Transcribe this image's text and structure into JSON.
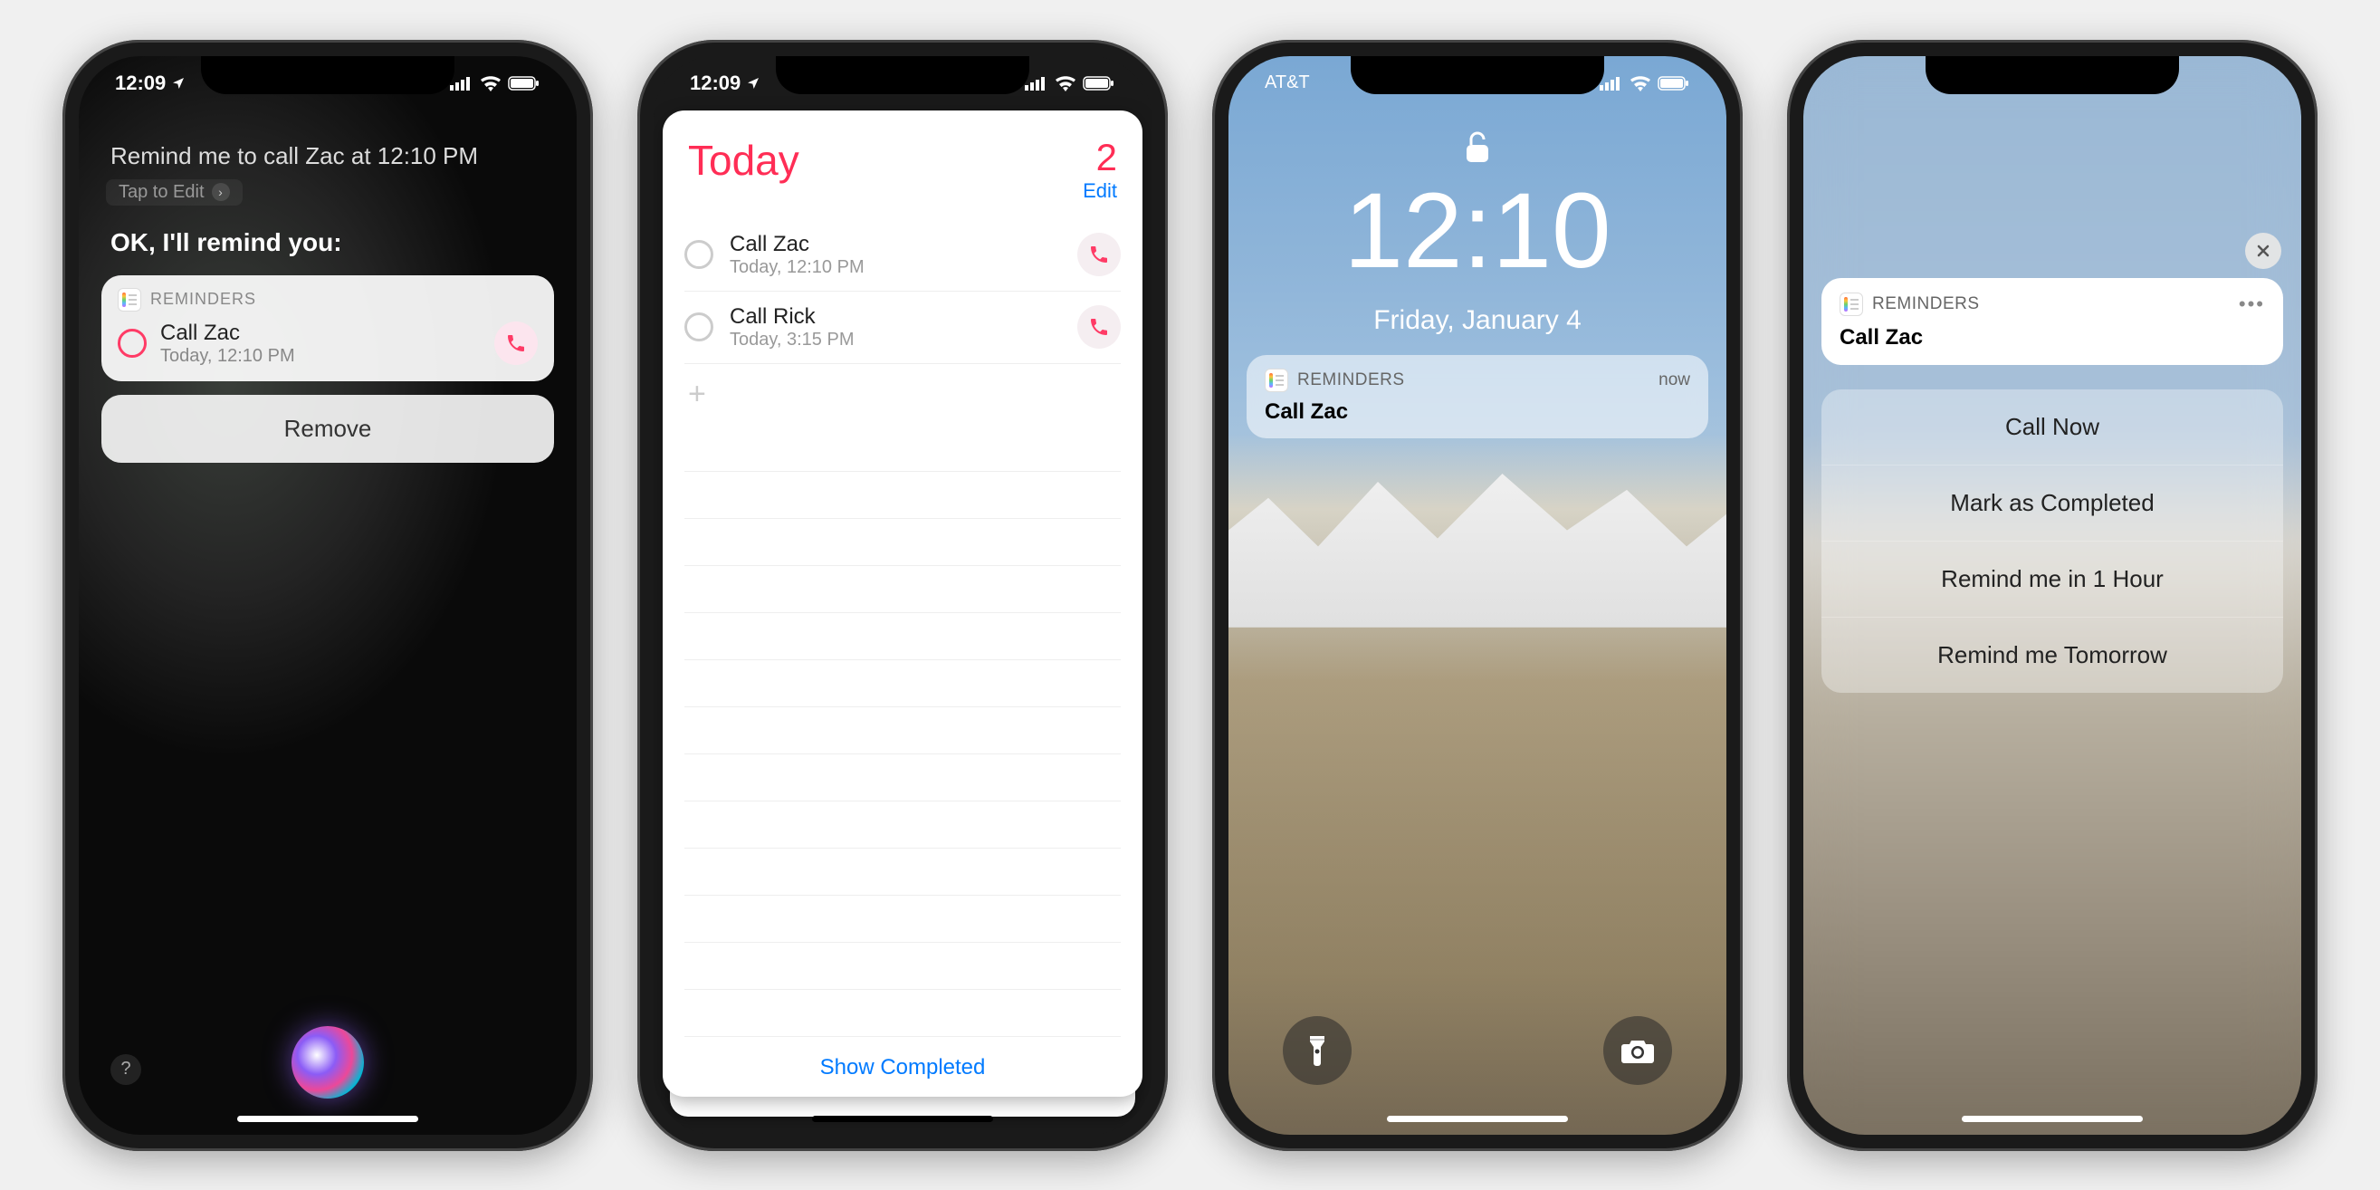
{
  "phone1": {
    "status_time": "12:09",
    "siri_prompt": "Remind me to call Zac at 12:10 PM",
    "tap_to_edit": "Tap to Edit",
    "siri_response": "OK, I'll remind you:",
    "card_app": "REMINDERS",
    "reminder_title": "Call Zac",
    "reminder_sub": "Today, 12:10 PM",
    "remove": "Remove"
  },
  "phone2": {
    "status_time": "12:09",
    "title": "Today",
    "count": "2",
    "edit": "Edit",
    "items": [
      {
        "title": "Call Zac",
        "sub": "Today, 12:10 PM"
      },
      {
        "title": "Call Rick",
        "sub": "Today, 3:15 PM"
      }
    ],
    "show_completed": "Show Completed"
  },
  "phone3": {
    "carrier": "AT&T",
    "time": "12:10",
    "date": "Friday, January 4",
    "notif_app": "REMINDERS",
    "notif_time": "now",
    "notif_title": "Call Zac"
  },
  "phone4": {
    "notif_app": "REMINDERS",
    "notif_title": "Call Zac",
    "actions": [
      "Call Now",
      "Mark as Completed",
      "Remind me in 1 Hour",
      "Remind me Tomorrow"
    ]
  }
}
